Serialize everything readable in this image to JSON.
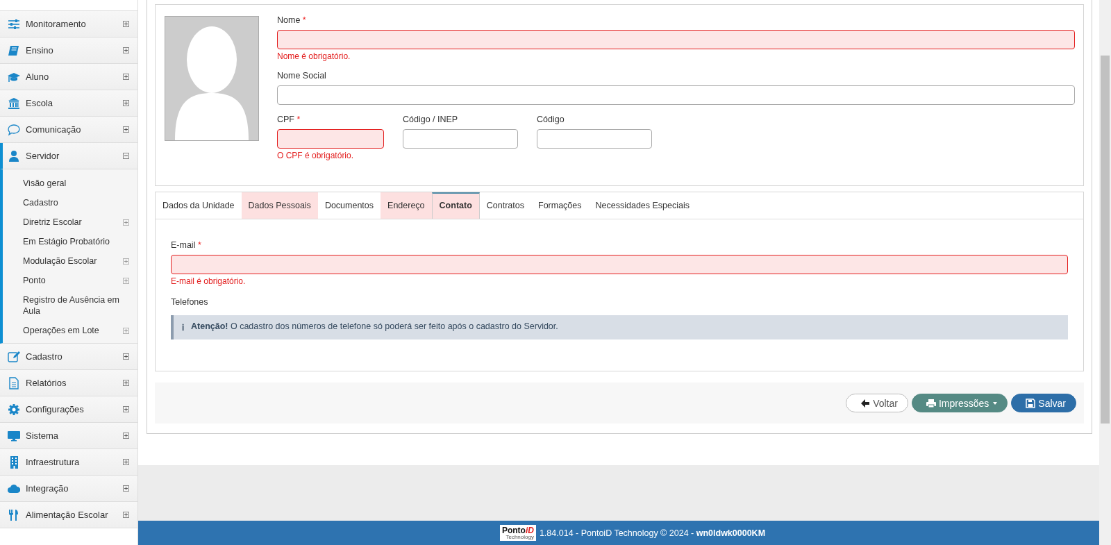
{
  "sidebar": {
    "items": [
      {
        "label": "Monitoramento",
        "expanded": false,
        "selected": false
      },
      {
        "label": "Ensino",
        "expanded": false,
        "selected": false
      },
      {
        "label": "Aluno",
        "expanded": false,
        "selected": false
      },
      {
        "label": "Escola",
        "expanded": false,
        "selected": false
      },
      {
        "label": "Comunicação",
        "expanded": false,
        "selected": false
      },
      {
        "label": "Servidor",
        "expanded": true,
        "selected": true,
        "children": [
          {
            "label": "Visão geral",
            "expandable": false
          },
          {
            "label": "Cadastro",
            "expandable": false
          },
          {
            "label": "Diretriz Escolar",
            "expandable": true
          },
          {
            "label": "Em Estágio Probatório",
            "expandable": false
          },
          {
            "label": "Modulação Escolar",
            "expandable": true
          },
          {
            "label": "Ponto",
            "expandable": true
          },
          {
            "label": "Registro de Ausência em Aula",
            "expandable": false
          },
          {
            "label": "Operações em Lote",
            "expandable": true
          }
        ]
      },
      {
        "label": "Cadastro",
        "expanded": false,
        "selected": false
      },
      {
        "label": "Relatórios",
        "expanded": false,
        "selected": false
      },
      {
        "label": "Configurações",
        "expanded": false,
        "selected": false
      },
      {
        "label": "Sistema",
        "expanded": false,
        "selected": false
      },
      {
        "label": "Infraestrutura",
        "expanded": false,
        "selected": false
      },
      {
        "label": "Integração",
        "expanded": false,
        "selected": false
      },
      {
        "label": "Alimentação Escolar",
        "expanded": false,
        "selected": false
      }
    ]
  },
  "form": {
    "name_fields": [
      {
        "label": "Nome",
        "required_mark": "*",
        "invalid": true,
        "error": "Nome é obrigatório."
      },
      {
        "label": "Nome Social",
        "invalid": false
      }
    ],
    "id_fields": [
      {
        "label": "CPF",
        "required_mark": "*",
        "invalid": true,
        "error": "O CPF é obrigatório."
      },
      {
        "label": "Código / INEP",
        "invalid": false
      },
      {
        "label": "Código",
        "invalid": false
      }
    ]
  },
  "tabs": [
    {
      "label": "Dados da Unidade",
      "selected": false,
      "invalid": false
    },
    {
      "label": "Dados Pessoais",
      "selected": false,
      "invalid": true
    },
    {
      "label": "Documentos",
      "selected": false,
      "invalid": false
    },
    {
      "label": "Endereço",
      "selected": false,
      "invalid": true
    },
    {
      "label": "Contato",
      "selected": true,
      "invalid": true
    },
    {
      "label": "Contratos",
      "selected": false,
      "invalid": false
    },
    {
      "label": "Formações",
      "selected": false,
      "invalid": false
    },
    {
      "label": "Necessidades Especiais",
      "selected": false,
      "invalid": false
    }
  ],
  "contact": {
    "email": {
      "label": "E-mail",
      "required_mark": "*",
      "invalid": true,
      "error": "E-mail é obrigatório."
    },
    "phones_label": "Telefones",
    "alert": {
      "icon": "ℹ",
      "text": "**Atenção!** O cadastro dos números de telefone só poderá ser feito após o cadastro do Servidor."
    }
  },
  "buttons": [
    {
      "label": "Voltar",
      "kind": "default"
    },
    {
      "label": "Impressões",
      "kind": "print"
    },
    {
      "label": "Salvar",
      "kind": "primary"
    }
  ],
  "footer": {
    "logo": {
      "main": "Ponto",
      "accent": "iD",
      "sub": "Technology"
    },
    "text": "1.84.014 - PontoiD Technology © 2024 - **wn0ldwk0000KM**"
  }
}
